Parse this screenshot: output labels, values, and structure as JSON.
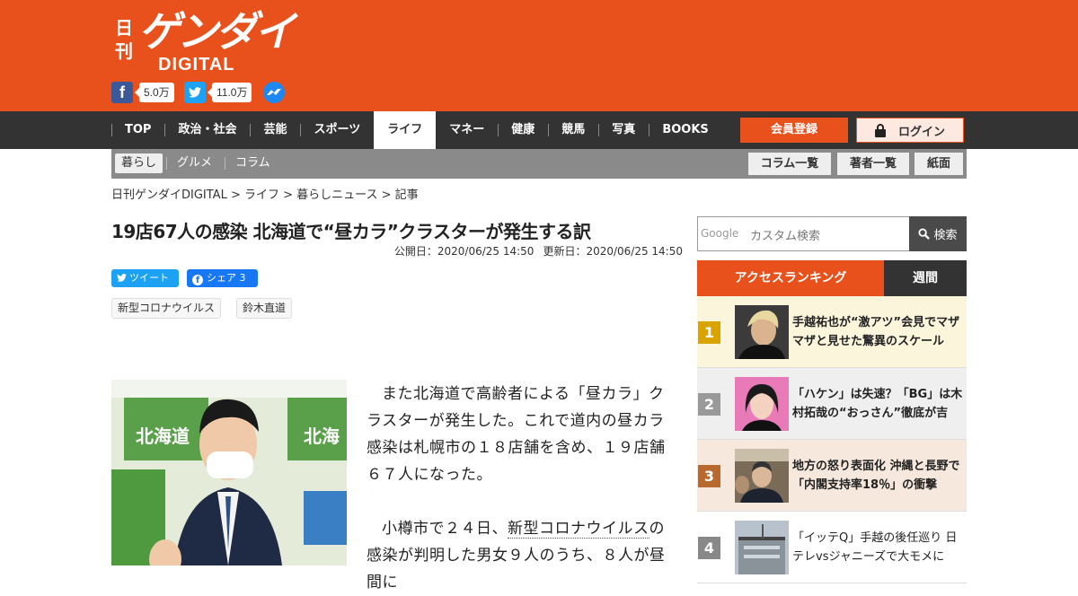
{
  "brand": {
    "kanji": "日刊",
    "name": "ゲンダイ",
    "sub": "DIGITAL"
  },
  "social": {
    "facebook_count": "5.0万",
    "twitter_count": "11.0万"
  },
  "nav": {
    "items": [
      "TOP",
      "政治・社会",
      "芸能",
      "スポーツ",
      "ライフ",
      "マネー",
      "健康",
      "競馬",
      "写真",
      "BOOKS"
    ],
    "active": "ライフ",
    "register": "会員登録",
    "login": "ログイン"
  },
  "subnav": {
    "items": [
      "暮らし",
      "グルメ",
      "コラム"
    ],
    "buttons": [
      "コラム一覧",
      "著者一覧",
      "紙面"
    ]
  },
  "breadcrumb": "日刊ゲンダイDIGITAL > ライフ > 暮らしニュース > 記事",
  "article": {
    "title": "19店67人の感染 北海道で“昼カラ”クラスターが発生する訳",
    "published": "公開日：2020/06/25 14:50",
    "updated": "更新日：2020/06/25 14:50",
    "tweet": "ツイート",
    "share": "シェア 3",
    "tags": [
      "新型コロナウイルス",
      "鈴木直道"
    ],
    "para1": "また北海道で高齢者による「昼カラ」クラスターが発生した。これで道内の昼カラ感染は札幌市の１８店舗を含め、１９店舗６７人になった。",
    "para2_before": "小樽市で２４日、",
    "para2_link": "新型コロナウイルス",
    "para2_after": "の感染が判明した男女９人のうち、８人が昼間に",
    "photo_sign": "北海道"
  },
  "search": {
    "logo": "Google",
    "placeholder": "カスタム検索",
    "button": "検索"
  },
  "ranking": {
    "heading": "アクセスランキング",
    "tab": "週間",
    "items": [
      {
        "rank": "1",
        "title": "手越祐也が“激アツ”会見でマザマザと見せた驚異のスケール",
        "color": "#d9a400",
        "bg": "#fbf5dc"
      },
      {
        "rank": "2",
        "title": "「ハケン」は失速？「BG」は木村拓哉の“おっさん”徹底が吉",
        "color": "#999999",
        "bg": "#efefef"
      },
      {
        "rank": "3",
        "title": "地方の怒り表面化 沖縄と長野で「内閣支持率18％」の衝撃",
        "color": "#b86a2e",
        "bg": "#f6e8dc"
      },
      {
        "rank": "4",
        "title": "「イッテQ」手越の後任巡り 日テレvsジャニーズで大モメに",
        "color": "#888888",
        "bg": "#ffffff"
      }
    ]
  }
}
